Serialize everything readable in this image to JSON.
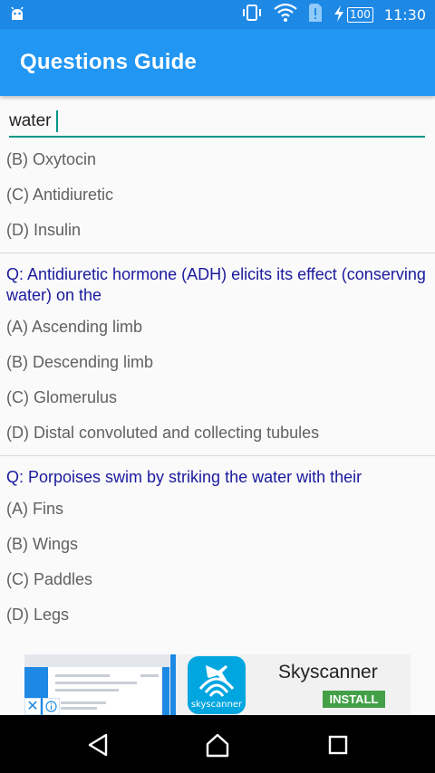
{
  "status_bar": {
    "time": "11:30",
    "battery_level": "100",
    "icons": [
      "android-icon",
      "vibrate-icon",
      "wifi-icon",
      "sim-alert-icon",
      "charging-icon"
    ]
  },
  "app_bar": {
    "title": "Questions Guide"
  },
  "search": {
    "value": "water"
  },
  "items": [
    {
      "type": "option",
      "text": "(B) Oxytocin"
    },
    {
      "type": "option",
      "text": "(C) Antidiuretic"
    },
    {
      "type": "option",
      "text": "(D) Insulin"
    },
    {
      "type": "divider"
    },
    {
      "type": "question",
      "text": "Q: Antidiuretic hormone (ADH) elicits its effect (conserving water) on the"
    },
    {
      "type": "option",
      "text": "(A) Ascending limb"
    },
    {
      "type": "option",
      "text": "(B) Descending limb"
    },
    {
      "type": "option",
      "text": "(C) Glomerulus"
    },
    {
      "type": "option",
      "text": "(D) Distal convoluted and collecting tubules"
    },
    {
      "type": "divider"
    },
    {
      "type": "question",
      "text": "Q: Porpoises swim by striking the water with their"
    },
    {
      "type": "option",
      "text": "(A) Fins"
    },
    {
      "type": "option",
      "text": "(B) Wings"
    },
    {
      "type": "option",
      "text": "(C) Paddles"
    },
    {
      "type": "option",
      "text": "(D) Legs"
    }
  ],
  "ad": {
    "brand": "Skyscanner",
    "logo_text": "skyscanner",
    "install_label": "INSTALL",
    "close_label": "✕"
  },
  "colors": {
    "status_bar": "#1e88e5",
    "app_bar": "#2196f3",
    "accent": "#009688",
    "question_text": "#1a1a9e",
    "option_text": "#616161"
  }
}
